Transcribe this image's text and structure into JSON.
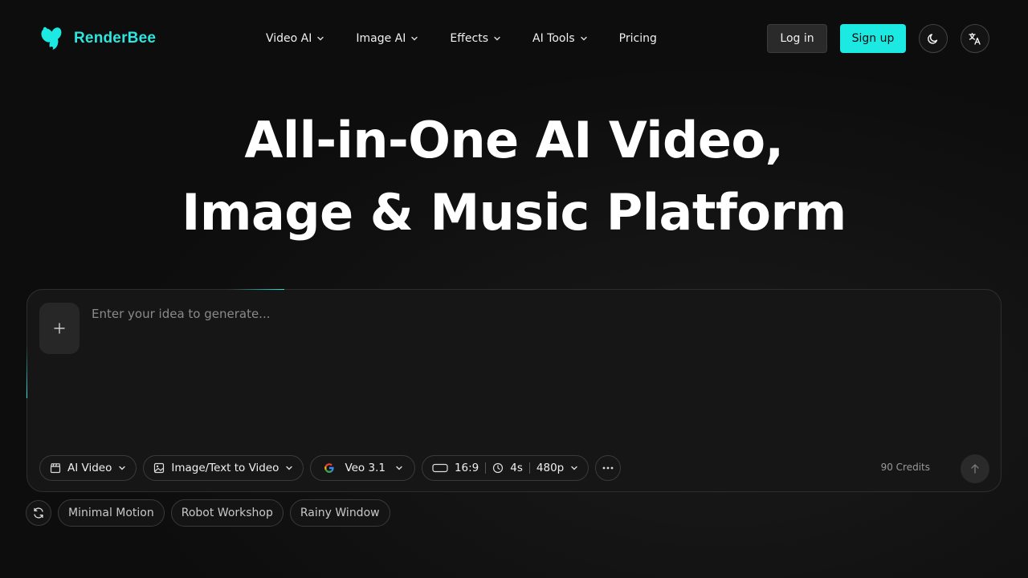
{
  "brand": {
    "name": "RenderBee",
    "accent": "#1de9e3"
  },
  "nav": [
    {
      "label": "Video AI",
      "dropdown": true
    },
    {
      "label": "Image AI",
      "dropdown": true
    },
    {
      "label": "Effects",
      "dropdown": true
    },
    {
      "label": "AI Tools",
      "dropdown": true
    },
    {
      "label": "Pricing",
      "dropdown": false
    }
  ],
  "auth": {
    "login_label": "Log in",
    "signup_label": "Sign up"
  },
  "icons": {
    "theme": "moon-icon",
    "language": "translate-icon"
  },
  "hero": {
    "line1": "All-in-One AI Video,",
    "line2": "Image & Music Platform"
  },
  "composer": {
    "placeholder": "Enter your idea to generate...",
    "mode_label": "AI Video",
    "input_type_label": "Image/Text to Video",
    "model_label": "Veo 3.1",
    "aspect_label": "16:9",
    "duration_label": "4s",
    "resolution_label": "480p",
    "credits_label": "90 Credits"
  },
  "suggestions": [
    "Minimal Motion",
    "Robot Workshop",
    "Rainy Window"
  ]
}
